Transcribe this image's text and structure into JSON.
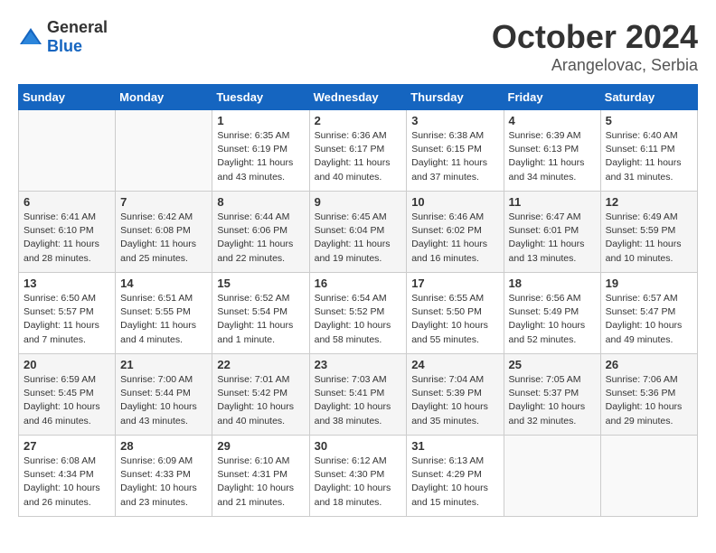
{
  "header": {
    "logo_general": "General",
    "logo_blue": "Blue",
    "month": "October 2024",
    "location": "Arangelovac, Serbia"
  },
  "weekdays": [
    "Sunday",
    "Monday",
    "Tuesday",
    "Wednesday",
    "Thursday",
    "Friday",
    "Saturday"
  ],
  "weeks": [
    [
      {
        "day": "",
        "info": ""
      },
      {
        "day": "",
        "info": ""
      },
      {
        "day": "1",
        "info": "Sunrise: 6:35 AM\nSunset: 6:19 PM\nDaylight: 11 hours and 43 minutes."
      },
      {
        "day": "2",
        "info": "Sunrise: 6:36 AM\nSunset: 6:17 PM\nDaylight: 11 hours and 40 minutes."
      },
      {
        "day": "3",
        "info": "Sunrise: 6:38 AM\nSunset: 6:15 PM\nDaylight: 11 hours and 37 minutes."
      },
      {
        "day": "4",
        "info": "Sunrise: 6:39 AM\nSunset: 6:13 PM\nDaylight: 11 hours and 34 minutes."
      },
      {
        "day": "5",
        "info": "Sunrise: 6:40 AM\nSunset: 6:11 PM\nDaylight: 11 hours and 31 minutes."
      }
    ],
    [
      {
        "day": "6",
        "info": "Sunrise: 6:41 AM\nSunset: 6:10 PM\nDaylight: 11 hours and 28 minutes."
      },
      {
        "day": "7",
        "info": "Sunrise: 6:42 AM\nSunset: 6:08 PM\nDaylight: 11 hours and 25 minutes."
      },
      {
        "day": "8",
        "info": "Sunrise: 6:44 AM\nSunset: 6:06 PM\nDaylight: 11 hours and 22 minutes."
      },
      {
        "day": "9",
        "info": "Sunrise: 6:45 AM\nSunset: 6:04 PM\nDaylight: 11 hours and 19 minutes."
      },
      {
        "day": "10",
        "info": "Sunrise: 6:46 AM\nSunset: 6:02 PM\nDaylight: 11 hours and 16 minutes."
      },
      {
        "day": "11",
        "info": "Sunrise: 6:47 AM\nSunset: 6:01 PM\nDaylight: 11 hours and 13 minutes."
      },
      {
        "day": "12",
        "info": "Sunrise: 6:49 AM\nSunset: 5:59 PM\nDaylight: 11 hours and 10 minutes."
      }
    ],
    [
      {
        "day": "13",
        "info": "Sunrise: 6:50 AM\nSunset: 5:57 PM\nDaylight: 11 hours and 7 minutes."
      },
      {
        "day": "14",
        "info": "Sunrise: 6:51 AM\nSunset: 5:55 PM\nDaylight: 11 hours and 4 minutes."
      },
      {
        "day": "15",
        "info": "Sunrise: 6:52 AM\nSunset: 5:54 PM\nDaylight: 11 hours and 1 minute."
      },
      {
        "day": "16",
        "info": "Sunrise: 6:54 AM\nSunset: 5:52 PM\nDaylight: 10 hours and 58 minutes."
      },
      {
        "day": "17",
        "info": "Sunrise: 6:55 AM\nSunset: 5:50 PM\nDaylight: 10 hours and 55 minutes."
      },
      {
        "day": "18",
        "info": "Sunrise: 6:56 AM\nSunset: 5:49 PM\nDaylight: 10 hours and 52 minutes."
      },
      {
        "day": "19",
        "info": "Sunrise: 6:57 AM\nSunset: 5:47 PM\nDaylight: 10 hours and 49 minutes."
      }
    ],
    [
      {
        "day": "20",
        "info": "Sunrise: 6:59 AM\nSunset: 5:45 PM\nDaylight: 10 hours and 46 minutes."
      },
      {
        "day": "21",
        "info": "Sunrise: 7:00 AM\nSunset: 5:44 PM\nDaylight: 10 hours and 43 minutes."
      },
      {
        "day": "22",
        "info": "Sunrise: 7:01 AM\nSunset: 5:42 PM\nDaylight: 10 hours and 40 minutes."
      },
      {
        "day": "23",
        "info": "Sunrise: 7:03 AM\nSunset: 5:41 PM\nDaylight: 10 hours and 38 minutes."
      },
      {
        "day": "24",
        "info": "Sunrise: 7:04 AM\nSunset: 5:39 PM\nDaylight: 10 hours and 35 minutes."
      },
      {
        "day": "25",
        "info": "Sunrise: 7:05 AM\nSunset: 5:37 PM\nDaylight: 10 hours and 32 minutes."
      },
      {
        "day": "26",
        "info": "Sunrise: 7:06 AM\nSunset: 5:36 PM\nDaylight: 10 hours and 29 minutes."
      }
    ],
    [
      {
        "day": "27",
        "info": "Sunrise: 6:08 AM\nSunset: 4:34 PM\nDaylight: 10 hours and 26 minutes."
      },
      {
        "day": "28",
        "info": "Sunrise: 6:09 AM\nSunset: 4:33 PM\nDaylight: 10 hours and 23 minutes."
      },
      {
        "day": "29",
        "info": "Sunrise: 6:10 AM\nSunset: 4:31 PM\nDaylight: 10 hours and 21 minutes."
      },
      {
        "day": "30",
        "info": "Sunrise: 6:12 AM\nSunset: 4:30 PM\nDaylight: 10 hours and 18 minutes."
      },
      {
        "day": "31",
        "info": "Sunrise: 6:13 AM\nSunset: 4:29 PM\nDaylight: 10 hours and 15 minutes."
      },
      {
        "day": "",
        "info": ""
      },
      {
        "day": "",
        "info": ""
      }
    ]
  ]
}
